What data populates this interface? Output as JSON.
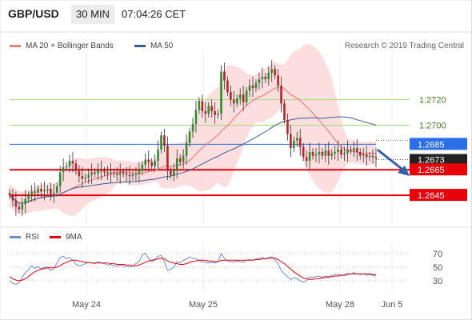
{
  "header": {
    "symbol": "GBP/USD",
    "timeframe": "30 MIN",
    "time": "07:04:26 CET"
  },
  "legend": {
    "ma20": "MA 20 + Bollinger Bands",
    "ma50": "MA 50",
    "rsi": "RSI",
    "ma9": "9MA"
  },
  "credit": "Research © 2019 Trading Central",
  "colors": {
    "ma20": "#f08080",
    "bollinger_fill": "#fcdada",
    "ma50": "#3b5c9a",
    "support_resistance_green": "#a3d977",
    "resistance_blue_line": "#2b6ee8",
    "support_red": "#e8000b",
    "current_price_box": "#222222",
    "rsi": "#6b8fd6",
    "ma9": "#e8000b",
    "arrow": "#2f5fa8"
  },
  "chart_data": [
    {
      "type": "candlestick",
      "title": "",
      "xlabel": "",
      "ylabel": "",
      "x_ticks": [
        "May 24",
        "May 25",
        "May 28",
        "Jun 5"
      ],
      "ylim": [
        1.2625,
        1.2758
      ],
      "grid": true,
      "levels": [
        {
          "value": "1.2720",
          "kind": "green"
        },
        {
          "value": "1.2700",
          "kind": "green"
        },
        {
          "value": "1.2685",
          "kind": "blue"
        },
        {
          "value": "1.2673",
          "kind": "current"
        },
        {
          "value": "1.2665",
          "kind": "red"
        },
        {
          "value": "1.2645",
          "kind": "red"
        }
      ],
      "close": [
        1.2645,
        1.2641,
        1.2636,
        1.2634,
        1.2638,
        1.2642,
        1.2645,
        1.2648,
        1.2647,
        1.265,
        1.2648,
        1.2649,
        1.265,
        1.2646,
        1.2647,
        1.2652,
        1.2663,
        1.2667,
        1.2668,
        1.2672,
        1.267,
        1.2664,
        1.266,
        1.2658,
        1.2659,
        1.2661,
        1.2663,
        1.2662,
        1.2665,
        1.2664,
        1.2663,
        1.2662,
        1.2663,
        1.2662,
        1.2661,
        1.2663,
        1.2662,
        1.2661,
        1.266,
        1.2661,
        1.2662,
        1.2664,
        1.2669,
        1.2673,
        1.2671,
        1.2668,
        1.2672,
        1.2681,
        1.2692,
        1.2684,
        1.2664,
        1.2661,
        1.2665,
        1.2674,
        1.2671,
        1.2676,
        1.2686,
        1.2695,
        1.2701,
        1.2712,
        1.2719,
        1.2711,
        1.2709,
        1.2715,
        1.2711,
        1.2708,
        1.2709,
        1.2742,
        1.2735,
        1.2726,
        1.272,
        1.2717,
        1.2721,
        1.2724,
        1.2718,
        1.2727,
        1.2731,
        1.2729,
        1.2733,
        1.2736,
        1.2738,
        1.2736,
        1.2741,
        1.2744,
        1.2739,
        1.2731,
        1.2717,
        1.2704,
        1.2693,
        1.2682,
        1.2688,
        1.269,
        1.2683,
        1.2675,
        1.2672,
        1.2679,
        1.2676,
        1.2677,
        1.2679,
        1.2676,
        1.268,
        1.2676,
        1.2678,
        1.2679,
        1.2681,
        1.2677,
        1.2678,
        1.2681,
        1.268,
        1.2682,
        1.2679,
        1.2676,
        1.2677,
        1.2675,
        1.2676,
        1.2675,
        1.2674
      ],
      "rsi": {
        "ylim": [
          10,
          85
        ],
        "ticks": [
          "70",
          "50",
          "30"
        ],
        "rsi": [
          30,
          26,
          25,
          27,
          35,
          42,
          46,
          52,
          48,
          51,
          47,
          50,
          50,
          45,
          47,
          56,
          64,
          66,
          62,
          64,
          60,
          54,
          52,
          53,
          55,
          57,
          56,
          55,
          58,
          56,
          55,
          53,
          54,
          52,
          51,
          53,
          52,
          51,
          50,
          52,
          55,
          58,
          68,
          70,
          63,
          58,
          60,
          66,
          67,
          58,
          45,
          47,
          50,
          58,
          56,
          60,
          62,
          65,
          63,
          62,
          60,
          58,
          57,
          56,
          57,
          56,
          58,
          70,
          63,
          59,
          58,
          57,
          59,
          58,
          57,
          60,
          61,
          60,
          62,
          63,
          64,
          62,
          64,
          65,
          61,
          55,
          45,
          40,
          36,
          32,
          34,
          33,
          30,
          28,
          30,
          36,
          35,
          36,
          37,
          35,
          37,
          36,
          38,
          39,
          40,
          38,
          39,
          41,
          40,
          42,
          40,
          39,
          40,
          38,
          39,
          38,
          37
        ],
        "ma9": [
          36,
          33,
          31,
          30,
          31,
          33,
          36,
          40,
          43,
          45,
          47,
          48,
          49,
          49,
          49,
          50,
          52,
          55,
          57,
          59,
          60,
          60,
          59,
          58,
          57,
          57,
          56,
          56,
          56,
          56,
          56,
          56,
          55,
          55,
          54,
          54,
          54,
          53,
          53,
          52,
          52,
          53,
          55,
          57,
          59,
          60,
          61,
          62,
          63,
          62,
          59,
          57,
          56,
          55,
          54,
          54,
          55,
          57,
          58,
          59,
          60,
          60,
          60,
          59,
          59,
          58,
          58,
          60,
          60,
          60,
          60,
          60,
          60,
          60,
          60,
          60,
          60,
          60,
          61,
          61,
          62,
          62,
          63,
          63,
          63,
          61,
          58,
          55,
          51,
          47,
          43,
          40,
          37,
          34,
          33,
          32,
          32,
          33,
          33,
          34,
          35,
          35,
          36,
          37,
          37,
          38,
          38,
          39,
          40,
          40,
          40,
          40,
          40,
          40,
          40,
          39,
          39
        ]
      }
    }
  ]
}
